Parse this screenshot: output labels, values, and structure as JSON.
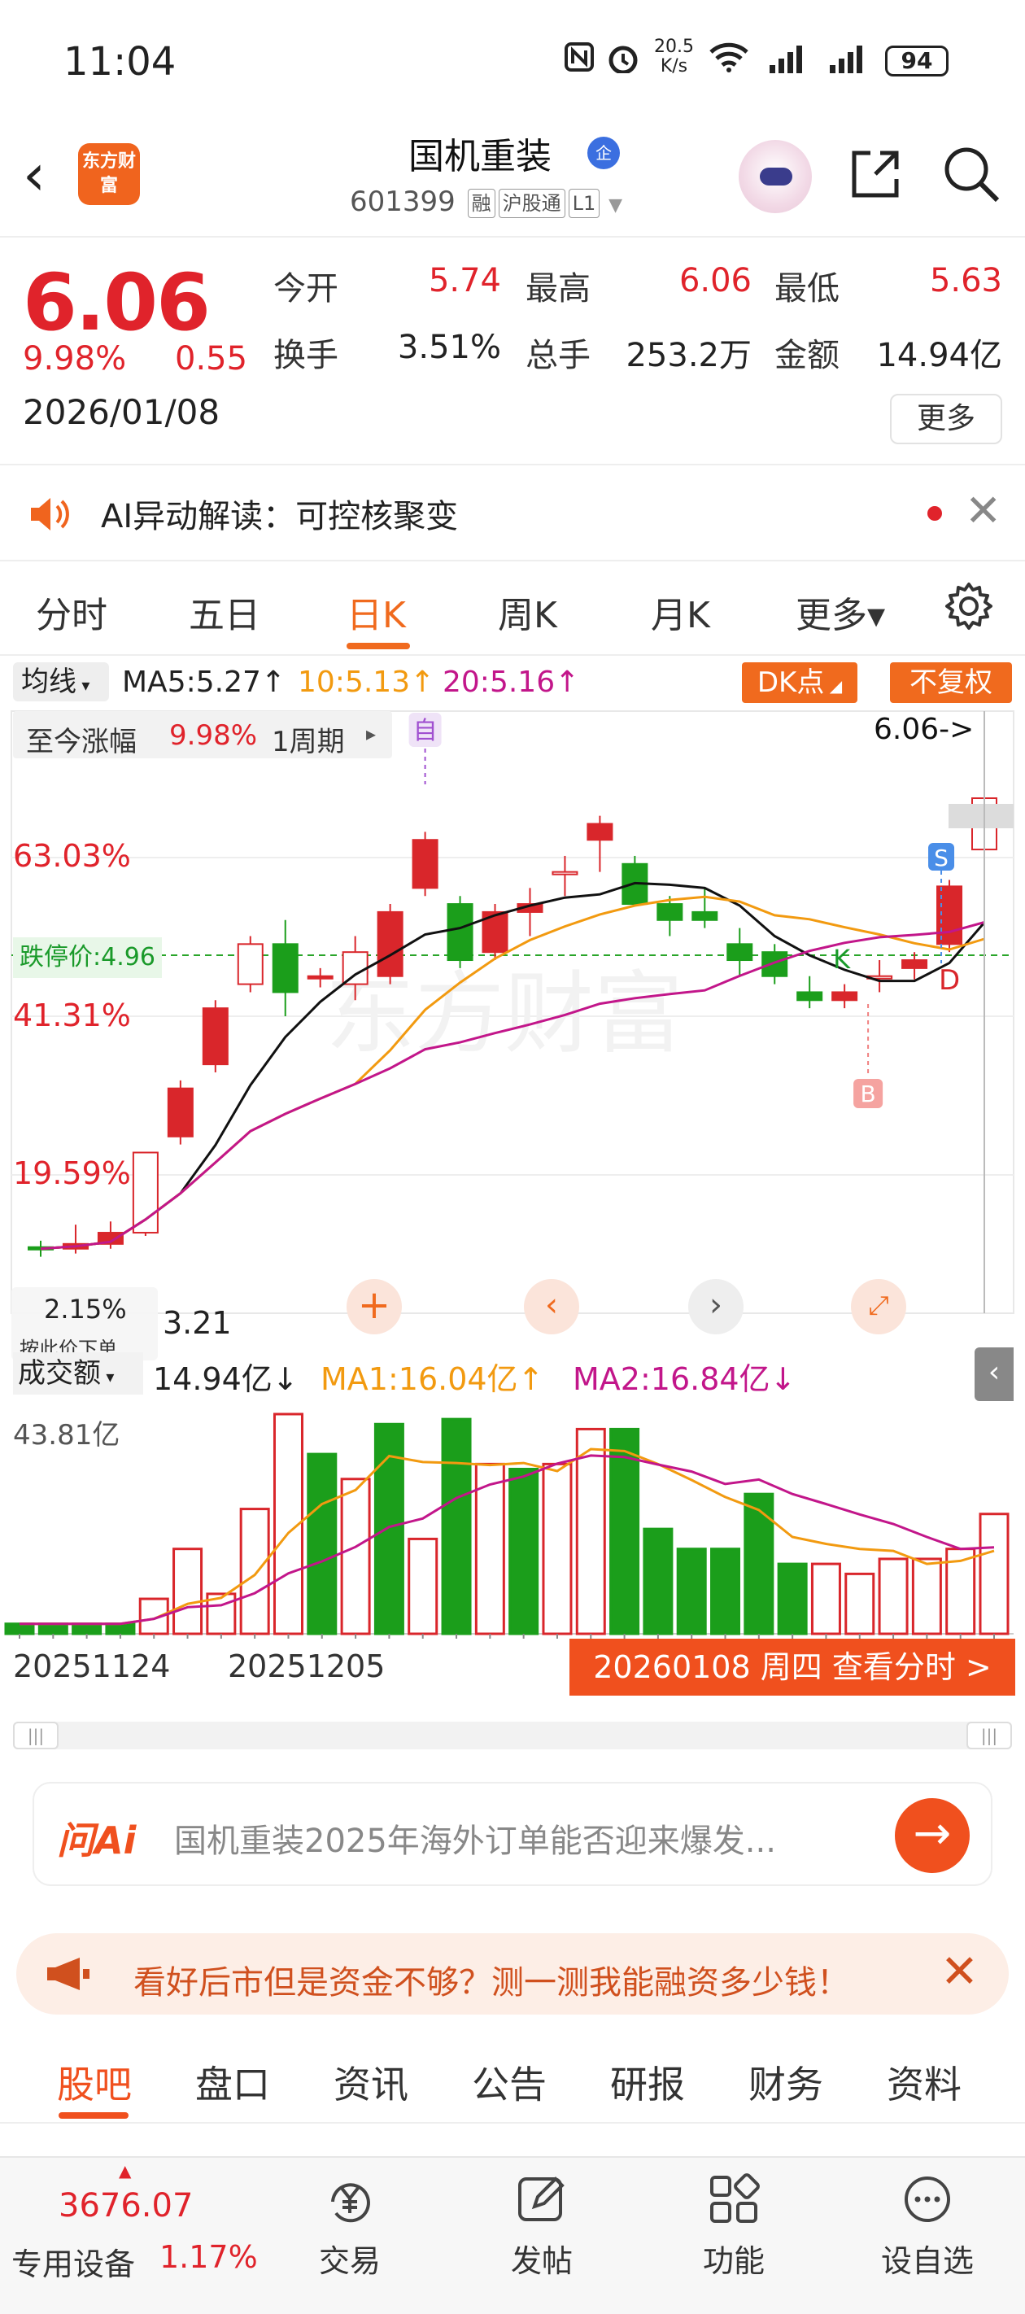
{
  "status_bar": {
    "time": "11:04",
    "net_speed": "20.5",
    "net_unit": "K/s",
    "battery": "94"
  },
  "header": {
    "logo_text": "东方财富",
    "stock_name": "国机重装",
    "badge": "企",
    "stock_code": "601399",
    "tags": [
      "融",
      "沪股通",
      "L1"
    ]
  },
  "quote": {
    "price": "6.06",
    "change_pct": "9.98%",
    "change": "0.55",
    "date": "2026/01/08",
    "open_label": "今开",
    "open": "5.74",
    "high_label": "最高",
    "high": "6.06",
    "low_label": "最低",
    "low": "5.63",
    "turnover_label": "换手",
    "turnover": "3.51%",
    "volume_label": "总手",
    "volume": "253.2万",
    "amount_label": "金额",
    "amount": "14.94亿",
    "more": "更多"
  },
  "ai_bar": {
    "text": "AI异动解读：可控核聚变"
  },
  "tabs": [
    "分时",
    "五日",
    "日K",
    "周K",
    "月K",
    "更多▾"
  ],
  "active_tab": "日K",
  "ma_row": {
    "select": "均线",
    "ma5": "MA5:5.27↑",
    "ma10": "10:5.13↑",
    "ma20": "20:5.16↑",
    "dk": "DK点",
    "fuquan": "不复权"
  },
  "kchart": {
    "gain_label": "至今涨幅",
    "gain_value": "9.98%",
    "period": "1周期",
    "price_tag": "6.06->",
    "levels": [
      "63.03%",
      "41.31%",
      "19.59%"
    ],
    "limit_down": "跌停价:4.96",
    "bottom_pct": "2.15%",
    "bottom_val": "3.21",
    "hint": "按此价下单",
    "marks": {
      "self": "自",
      "S": "S",
      "B": "B",
      "D": "D",
      "K": "K"
    },
    "colors": {
      "up": "#d9262b",
      "down": "#1b9e1b",
      "ma5": "#111111",
      "ma10": "#f29a10",
      "ma20": "#c2168a"
    },
    "watermark": "东方财富"
  },
  "chart_data": {
    "type": "candlestick",
    "ohlc": [
      [
        3.26,
        3.3,
        3.2,
        3.25
      ],
      [
        3.25,
        3.4,
        3.22,
        3.28
      ],
      [
        3.28,
        3.42,
        3.25,
        3.35
      ],
      [
        3.35,
        3.85,
        3.33,
        3.85
      ],
      [
        3.95,
        4.3,
        3.9,
        4.25
      ],
      [
        4.4,
        4.8,
        4.35,
        4.75
      ],
      [
        4.9,
        5.2,
        4.85,
        5.15
      ],
      [
        5.15,
        5.3,
        4.7,
        4.85
      ],
      [
        4.95,
        5.0,
        4.88,
        4.95
      ],
      [
        4.9,
        5.2,
        4.8,
        5.1
      ],
      [
        4.95,
        5.4,
        4.9,
        5.35
      ],
      [
        5.5,
        5.85,
        5.45,
        5.8
      ],
      [
        5.4,
        5.45,
        5.0,
        5.05
      ],
      [
        5.1,
        5.4,
        5.05,
        5.35
      ],
      [
        5.35,
        5.5,
        5.2,
        5.4
      ],
      [
        5.6,
        5.7,
        5.45,
        5.6
      ],
      [
        5.8,
        5.95,
        5.6,
        5.9
      ],
      [
        5.65,
        5.7,
        5.4,
        5.4
      ],
      [
        5.4,
        5.45,
        5.2,
        5.3
      ],
      [
        5.35,
        5.5,
        5.25,
        5.3
      ],
      [
        5.15,
        5.25,
        4.95,
        5.05
      ],
      [
        5.1,
        5.15,
        4.9,
        4.95
      ],
      [
        4.85,
        4.95,
        4.75,
        4.8
      ],
      [
        4.8,
        4.9,
        4.75,
        4.85
      ],
      [
        4.95,
        5.05,
        4.85,
        4.95
      ],
      [
        5.0,
        5.1,
        4.93,
        5.05
      ],
      [
        5.15,
        5.55,
        5.1,
        5.51
      ],
      [
        5.74,
        6.06,
        5.63,
        6.06
      ]
    ],
    "ma5": "5.27",
    "ma10": "5.13",
    "ma20": "5.16",
    "volume": {
      "label": "成交额",
      "value": "14.94亿↓",
      "ma1": "MA1:16.04亿↑",
      "ma2": "MA2:16.84亿↓",
      "max_label": "43.81亿",
      "bars": [
        2,
        2,
        2,
        2,
        7,
        17,
        8,
        25,
        44,
        36,
        31,
        42,
        19,
        43,
        34,
        33,
        34,
        41,
        41,
        21,
        17,
        17,
        28,
        14,
        14,
        12,
        15,
        15,
        17,
        24
      ]
    },
    "x_labels": [
      "20251124",
      "20251205"
    ]
  },
  "date_row": {
    "left": "20251124",
    "mid": "20251205",
    "btn": "20260108 周四 查看分时 >"
  },
  "ask_ai": {
    "logo": "问Ai",
    "text": "国机重装2025年海外订单能否迎来爆发..."
  },
  "fin_banner": {
    "text": "看好后市但是资金不够？测一测我能融资多少钱！"
  },
  "bottom_tabs": [
    "股吧",
    "盘口",
    "资讯",
    "公告",
    "研报",
    "财务",
    "资料"
  ],
  "bottom_nav": {
    "index_value": "3676.07",
    "index_name": "专用设备",
    "index_pct": "1.17%",
    "items": [
      "交易",
      "发帖",
      "功能",
      "设自选"
    ]
  }
}
